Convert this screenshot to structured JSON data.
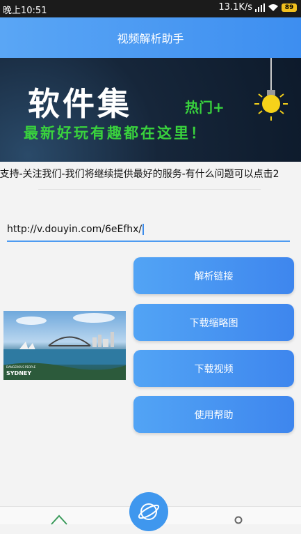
{
  "status_bar": {
    "time": "晚上10:51",
    "network_speed": "13.1K/s",
    "battery": "89"
  },
  "app_bar": {
    "title": "视频解析助手"
  },
  "banner": {
    "title": "软件集",
    "hot_label": "热门+",
    "slogan": "最新好玩有趣都在这里！"
  },
  "marquee": {
    "text": "]支持-关注我们-我们将继续提供最好的服务-有什么问题可以点击2"
  },
  "url_input": {
    "value": "http://v.douyin.com/6eEfhx/"
  },
  "buttons": {
    "parse": "解析链接",
    "download_thumbnail": "下载缩略图",
    "download_video": "下载视频",
    "help": "使用帮助"
  },
  "photo": {
    "caption_small": "DANGEROUS PEOPLE",
    "caption_city": "SYDNEY"
  },
  "colors": {
    "accent": "#4d9bf1",
    "banner_green": "#39d23d",
    "status_bar": "#1b1b1b"
  }
}
